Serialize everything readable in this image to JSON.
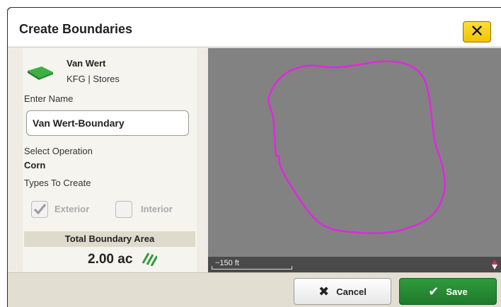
{
  "dialog": {
    "title": "Create Boundaries",
    "close_icon": "close-icon"
  },
  "field": {
    "name": "Van Wert",
    "subtitle": "KFG | Stores",
    "icon": "field-icon"
  },
  "form": {
    "enter_name_label": "Enter Name",
    "name_value": "Van Wert-Boundary",
    "select_operation_label": "Select Operation",
    "operation_value": "Corn",
    "types_label": "Types To Create",
    "exterior_label": "Exterior",
    "exterior_checked": true,
    "interior_label": "Interior",
    "interior_checked": false
  },
  "area": {
    "header": "Total Boundary Area",
    "value": "2.00 ac",
    "icon": "boundary-hatch-icon"
  },
  "map": {
    "boundary_color": "#e028e0",
    "scale_label": "~150 ft",
    "north_icon": "compass-icon"
  },
  "footer": {
    "cancel_label": "Cancel",
    "save_label": "Save"
  },
  "colors": {
    "accent_save": "#2a8c36",
    "close_button": "#f5c800",
    "map_background": "#828282"
  }
}
